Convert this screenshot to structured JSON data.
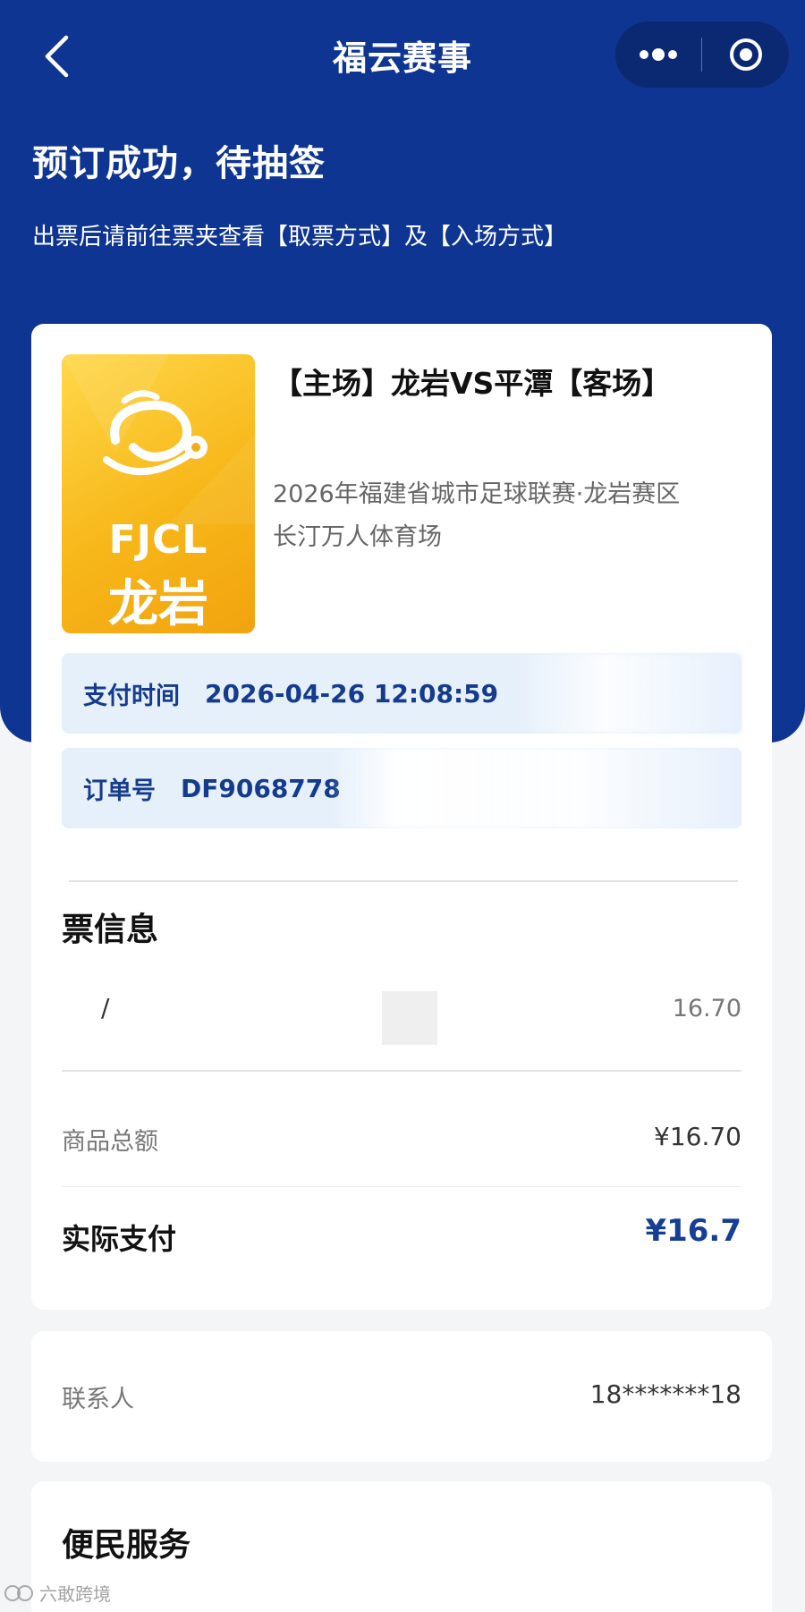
{
  "header": {
    "title": "福云赛事",
    "back_icon": "back-arrow-icon",
    "more_icon": "more-dots-icon",
    "target_icon": "target-icon"
  },
  "status": {
    "title": "预订成功，待抽签",
    "subtitle": "出票后请前往票夹查看【取票方式】及【入场方式】"
  },
  "event": {
    "poster_logo_text": "FJCL",
    "poster_city": "龙岩",
    "title": "【主场】龙岩VS平潭【客场】",
    "league": "2026年福建省城市足球联赛·龙岩赛区",
    "venue": "长汀万人体育场"
  },
  "payment": {
    "time_label": "支付时间",
    "time_value": "2026-04-26 12:08:59",
    "order_label": "订单号",
    "order_value": "DF9068778"
  },
  "tickets": {
    "section_title": "票信息",
    "slash": "/",
    "price": "16.70"
  },
  "totals": {
    "goods_label": "商品总额",
    "goods_value": "¥16.70",
    "actual_label": "实际支付",
    "actual_value": "¥16.7"
  },
  "contact": {
    "label": "联系人",
    "value": "18*******18"
  },
  "service": {
    "title": "便民服务"
  },
  "watermark": {
    "text": "六敢跨境"
  },
  "colors": {
    "brand_blue": "#0f3592",
    "info_bg": "#e6f0fb",
    "accent_text": "#163e94"
  }
}
